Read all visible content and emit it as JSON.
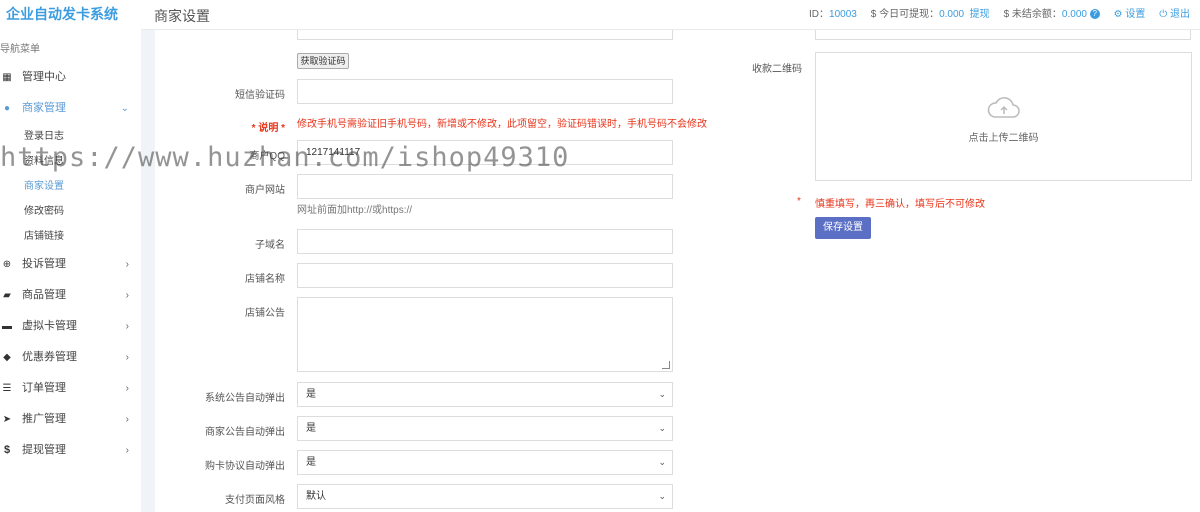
{
  "app": {
    "title": "企业自动发卡系统"
  },
  "sidebar": {
    "nav_title": "导航菜单",
    "items": [
      {
        "label": "管理中心",
        "icon": "dashboard-icon",
        "chevron": false
      },
      {
        "label": "商家管理",
        "icon": "user-icon",
        "chevron": true,
        "expanded": true,
        "sub": [
          "登录日志",
          "资料信息",
          "商家设置",
          "修改密码",
          "店铺链接"
        ],
        "active_sub": "商家设置"
      },
      {
        "label": "投诉管理",
        "icon": "complaint-icon",
        "chevron": true
      },
      {
        "label": "商品管理",
        "icon": "shopping-bag-icon",
        "chevron": true
      },
      {
        "label": "虚拟卡管理",
        "icon": "card-icon",
        "chevron": true
      },
      {
        "label": "优惠券管理",
        "icon": "tag-icon",
        "chevron": true
      },
      {
        "label": "订单管理",
        "icon": "list-icon",
        "chevron": true
      },
      {
        "label": "推广管理",
        "icon": "paper-plane-icon",
        "chevron": true
      },
      {
        "label": "提现管理",
        "icon": "dollar-icon",
        "chevron": true
      }
    ]
  },
  "header": {
    "page_title": "商家设置",
    "id_label": "ID：",
    "id_value": "10003",
    "withdraw_label": "$ 今日可提现：",
    "withdraw_value": "0.000",
    "withdraw_link": "提现",
    "unsettled_label": "$ 未结余额：",
    "unsettled_value": "0.000",
    "settings_label": "设置",
    "logout_label": "退出"
  },
  "form": {
    "get_code_button": "获取验证码",
    "sms_code_label": "短信验证码",
    "sms_code_value": "",
    "note_label": "* 说明 *",
    "note_text": "修改手机号需验证旧手机号码，新增或不修改，此项留空，验证码错误时，手机号码不会修改",
    "qq_label": "商户QQ",
    "qq_value": "1217141117",
    "website_label": "商户网站",
    "website_value": "",
    "website_hint": "网址前面加http://或https://",
    "subdomain_label": "子域名",
    "subdomain_value": "",
    "shop_name_label": "店铺名称",
    "shop_name_value": "",
    "announcement_label": "店铺公告",
    "announcement_value": "",
    "sys_popup_label": "系统公告自动弹出",
    "sys_popup_value": "是",
    "merchant_popup_label": "商家公告自动弹出",
    "merchant_popup_value": "是",
    "agreement_popup_label": "购卡协议自动弹出",
    "agreement_popup_value": "是",
    "pay_style_label": "支付页面风格",
    "pay_style_value": "默认",
    "qr_label": "收款二维码",
    "qr_upload_text": "点击上传二维码",
    "warning_star": "*",
    "warning_text": "慎重填写，再三确认，填写后不可修改",
    "save_button": "保存设置"
  },
  "watermark": "https://www.huzhan.com/ishop49310",
  "colors": {
    "accent": "#3b9de0",
    "button": "#5b6fc4",
    "warning": "#e8341a"
  }
}
